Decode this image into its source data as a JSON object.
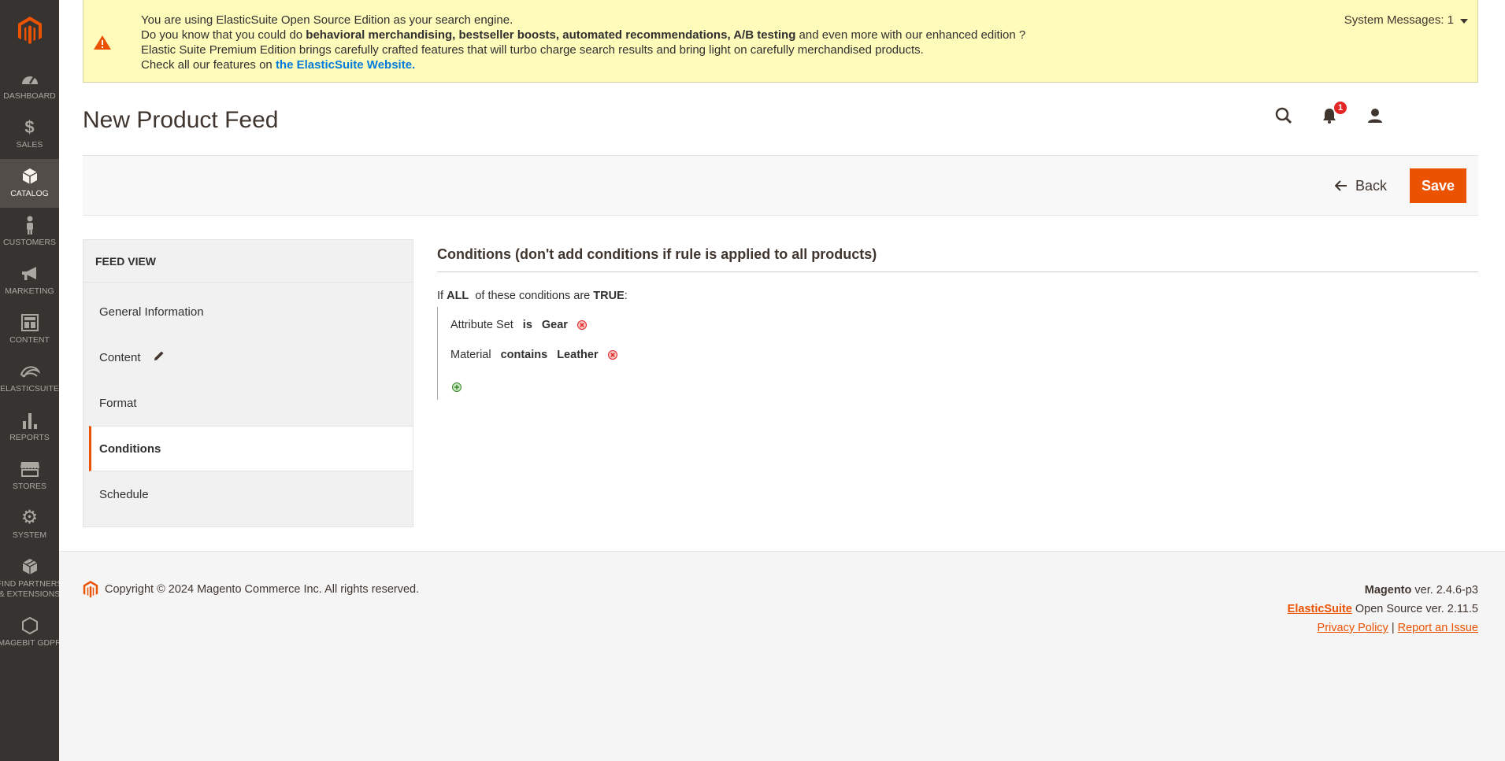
{
  "sidebar": {
    "items": [
      {
        "key": "dashboard",
        "label": "DASHBOARD",
        "icon": "gauge-icon"
      },
      {
        "key": "sales",
        "label": "SALES",
        "icon": "dollar-icon"
      },
      {
        "key": "catalog",
        "label": "CATALOG",
        "icon": "box-icon",
        "active": true
      },
      {
        "key": "customers",
        "label": "CUSTOMERS",
        "icon": "person-icon"
      },
      {
        "key": "marketing",
        "label": "MARKETING",
        "icon": "megaphone-icon"
      },
      {
        "key": "content",
        "label": "CONTENT",
        "icon": "layout-icon"
      },
      {
        "key": "elasticsuite",
        "label": "ELASTICSUITE",
        "icon": "elasticsuite-icon"
      },
      {
        "key": "reports",
        "label": "REPORTS",
        "icon": "bar-chart-icon"
      },
      {
        "key": "stores",
        "label": "STORES",
        "icon": "store-icon"
      },
      {
        "key": "system",
        "label": "SYSTEM",
        "icon": "gear-icon"
      },
      {
        "key": "partners",
        "label": "FIND PARTNERS & EXTENSIONS",
        "label_line1": "FIND PARTNERS",
        "label_line2": "& EXTENSIONS",
        "icon": "cube-icon"
      },
      {
        "key": "gdpr",
        "label": "MAGEBIT GDPR",
        "icon": "hexagon-icon"
      }
    ]
  },
  "notice": {
    "line1": "You are using ElasticSuite Open Source Edition as your search engine.",
    "line2_pre": "Do you know that you could do ",
    "line2_bold": "behavioral merchandising, bestseller boosts, automated recommendations, A/B testing",
    "line2_post": " and even more with our enhanced edition ?",
    "line3": "Elastic Suite Premium Edition brings carefully crafted features that will turbo charge search results and bring light on carefully merchandised products.",
    "line4_pre": "Check all our features on ",
    "line4_link": "the ElasticSuite Website.",
    "system_messages": "System Messages: 1"
  },
  "header": {
    "title": "New Product Feed",
    "notification_count": "1"
  },
  "actions": {
    "back": "Back",
    "save": "Save"
  },
  "tabs": {
    "title": "FEED VIEW",
    "items": [
      {
        "label": "General Information"
      },
      {
        "label": "Content"
      },
      {
        "label": "Format"
      },
      {
        "label": "Conditions"
      },
      {
        "label": "Schedule"
      }
    ]
  },
  "conditions": {
    "title": "Conditions (don't add conditions if rule is applied to all products)",
    "if": "If",
    "aggregator": "ALL",
    "of_these": "of these conditions are",
    "value": "TRUE",
    "colon": ":",
    "rows": [
      {
        "attribute": "Attribute Set",
        "operator": "is",
        "value": "Gear"
      },
      {
        "attribute": "Material",
        "operator": "contains",
        "value": "Leather"
      }
    ]
  },
  "footer": {
    "copyright": "Copyright © 2024 Magento Commerce Inc. All rights reserved.",
    "magento": "Magento",
    "magento_ver": " ver. 2.4.6-p3",
    "elasticsuite": "ElasticSuite",
    "elasticsuite_ver": " Open Source ver. 2.11.5",
    "privacy": "Privacy Policy",
    "separator": " | ",
    "report": "Report an Issue"
  },
  "colors": {
    "accent": "#eb5202",
    "sidebar_bg": "#373330",
    "notice_bg": "#fffbbb",
    "link": "#007bdb",
    "badge": "#e22626"
  }
}
